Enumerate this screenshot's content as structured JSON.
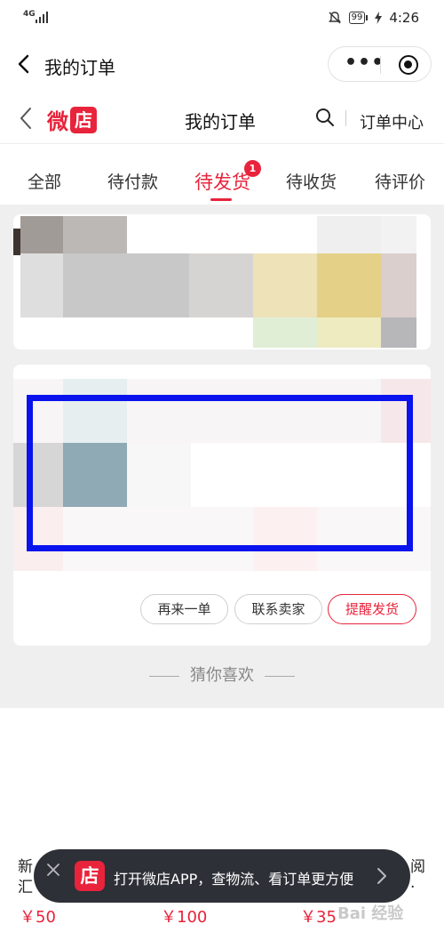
{
  "status_bar": {
    "network": "4G",
    "battery": "99",
    "time": "4:26"
  },
  "miniprogram_nav": {
    "title": "我的订单"
  },
  "shop_nav": {
    "logo_text": "微",
    "logo_badge": "店",
    "title": "我的订单",
    "order_center": "订单中心"
  },
  "tabs": [
    {
      "label": "全部"
    },
    {
      "label": "待付款"
    },
    {
      "label": "待发货",
      "active": true,
      "badge": "1"
    },
    {
      "label": "待收货"
    },
    {
      "label": "待评价"
    }
  ],
  "order_actions": {
    "reorder": "再来一单",
    "contact_seller": "联系卖家",
    "remind_ship": "提醒发货"
  },
  "recommend": {
    "title": "猜你喜欢"
  },
  "products": [
    {
      "title_line1": "新",
      "title_line2": "汇",
      "price": "￥50"
    },
    {
      "title_line2": "",
      "price": "￥100"
    },
    {
      "title_line1": "阅",
      "title_line2": "·",
      "price": "￥35"
    }
  ],
  "app_banner": {
    "logo": "店",
    "text": "打开微店APP，查物流、看订单更方便"
  },
  "watermark": "Bai 经验",
  "colors": {
    "brand_red": "#e8233b",
    "highlight_box": "#0a12ee",
    "banner_bg": "#2e3038"
  }
}
